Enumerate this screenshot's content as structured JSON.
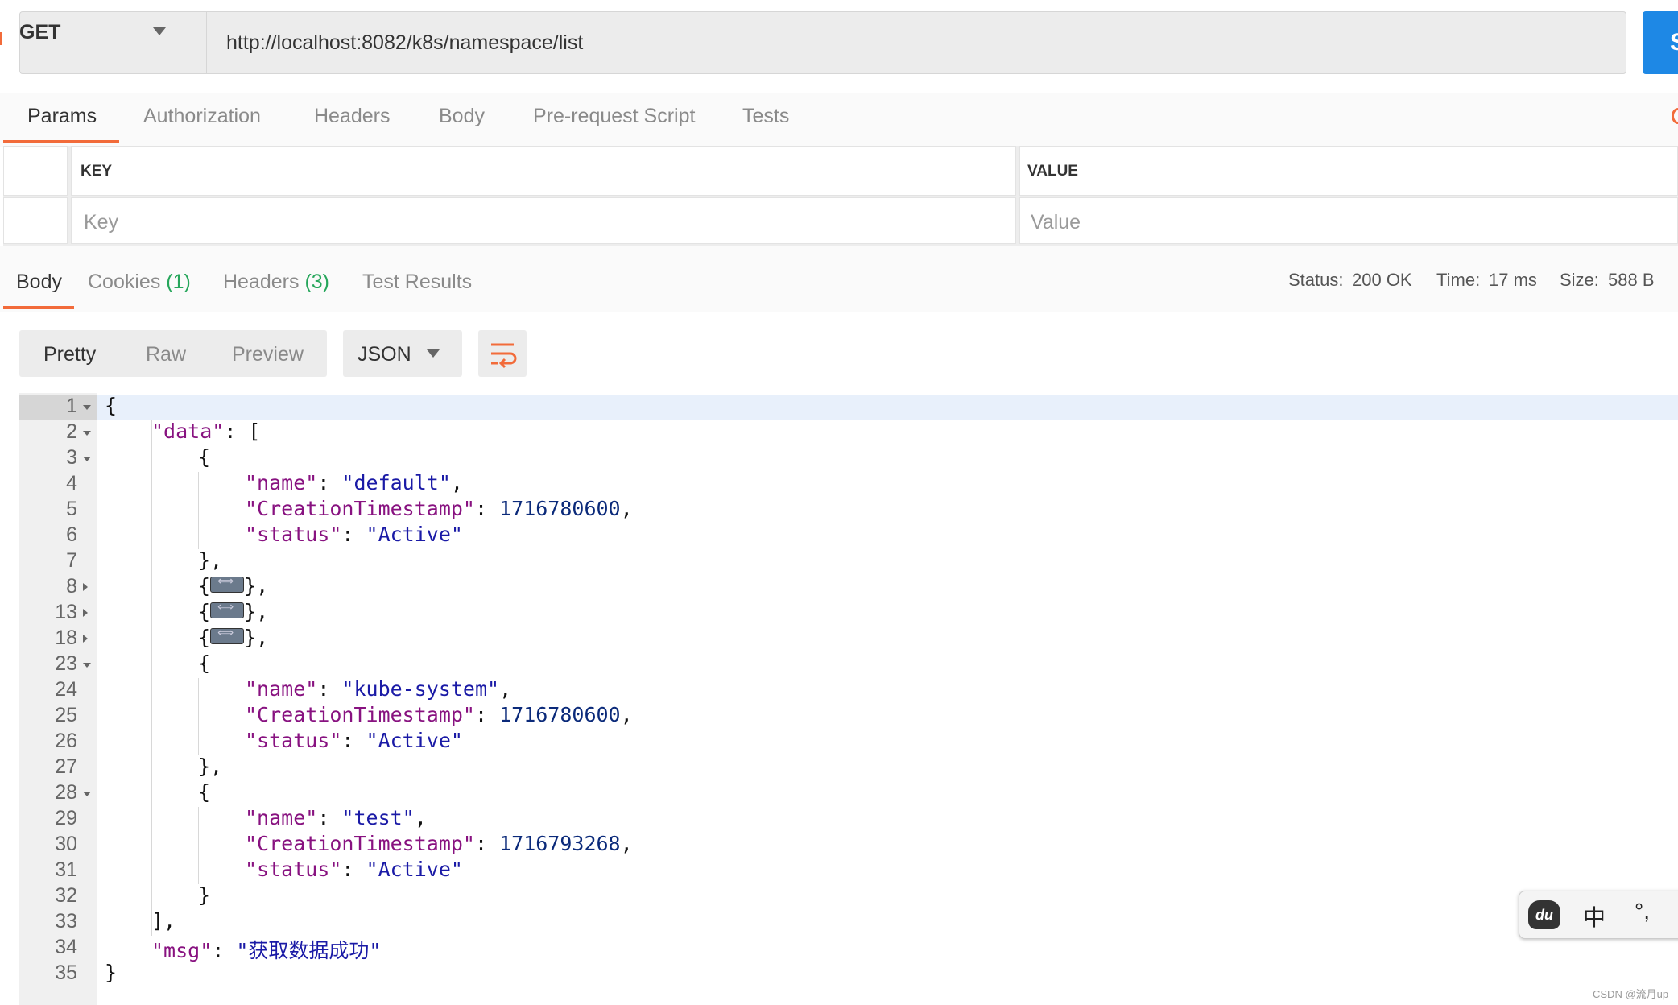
{
  "request": {
    "method": "GET",
    "url": "http://localhost:8082/k8s/namespace/list",
    "send_label": "S"
  },
  "request_tabs": [
    "Params",
    "Authorization",
    "Headers",
    "Body",
    "Pre-request Script",
    "Tests"
  ],
  "params": {
    "key_header": "KEY",
    "value_header": "VALUE",
    "key_placeholder": "Key",
    "value_placeholder": "Value"
  },
  "response_tabs": {
    "body": "Body",
    "cookies": "Cookies",
    "cookies_count": "(1)",
    "headers": "Headers",
    "headers_count": "(3)",
    "test_results": "Test Results"
  },
  "status": {
    "status_label": "Status:",
    "status_value": "200 OK",
    "time_label": "Time:",
    "time_value": "17 ms",
    "size_label": "Size:",
    "size_value": "588 B"
  },
  "format": {
    "pretty": "Pretty",
    "raw": "Raw",
    "preview": "Preview",
    "type": "JSON"
  },
  "code": {
    "line_numbers": [
      "1",
      "2",
      "3",
      "4",
      "5",
      "6",
      "7",
      "8",
      "13",
      "18",
      "23",
      "24",
      "25",
      "26",
      "27",
      "28",
      "29",
      "30",
      "31",
      "32",
      "33",
      "34",
      "35"
    ],
    "key_data": "\"data\"",
    "key_name": "\"name\"",
    "key_ts": "\"CreationTimestamp\"",
    "key_status": "\"status\"",
    "key_msg": "\"msg\"",
    "items": [
      {
        "name": "\"default\"",
        "ts": "1716780600",
        "status": "\"Active\""
      },
      {
        "name": "\"kube-system\"",
        "ts": "1716780600",
        "status": "\"Active\""
      },
      {
        "name": "\"test\"",
        "ts": "1716793268",
        "status": "\"Active\""
      }
    ],
    "msg": "\"获取数据成功\""
  },
  "ime": {
    "logo": "du",
    "lang": "中",
    "punct": "°,"
  },
  "watermark": "CSDN @流月up",
  "colors": {
    "accent": "#f26b3a",
    "send": "#1e88e5",
    "status_green": "#26a65b",
    "json_key": "#881280",
    "json_string": "#1a1aa6",
    "json_number": "#0b2a7a"
  }
}
